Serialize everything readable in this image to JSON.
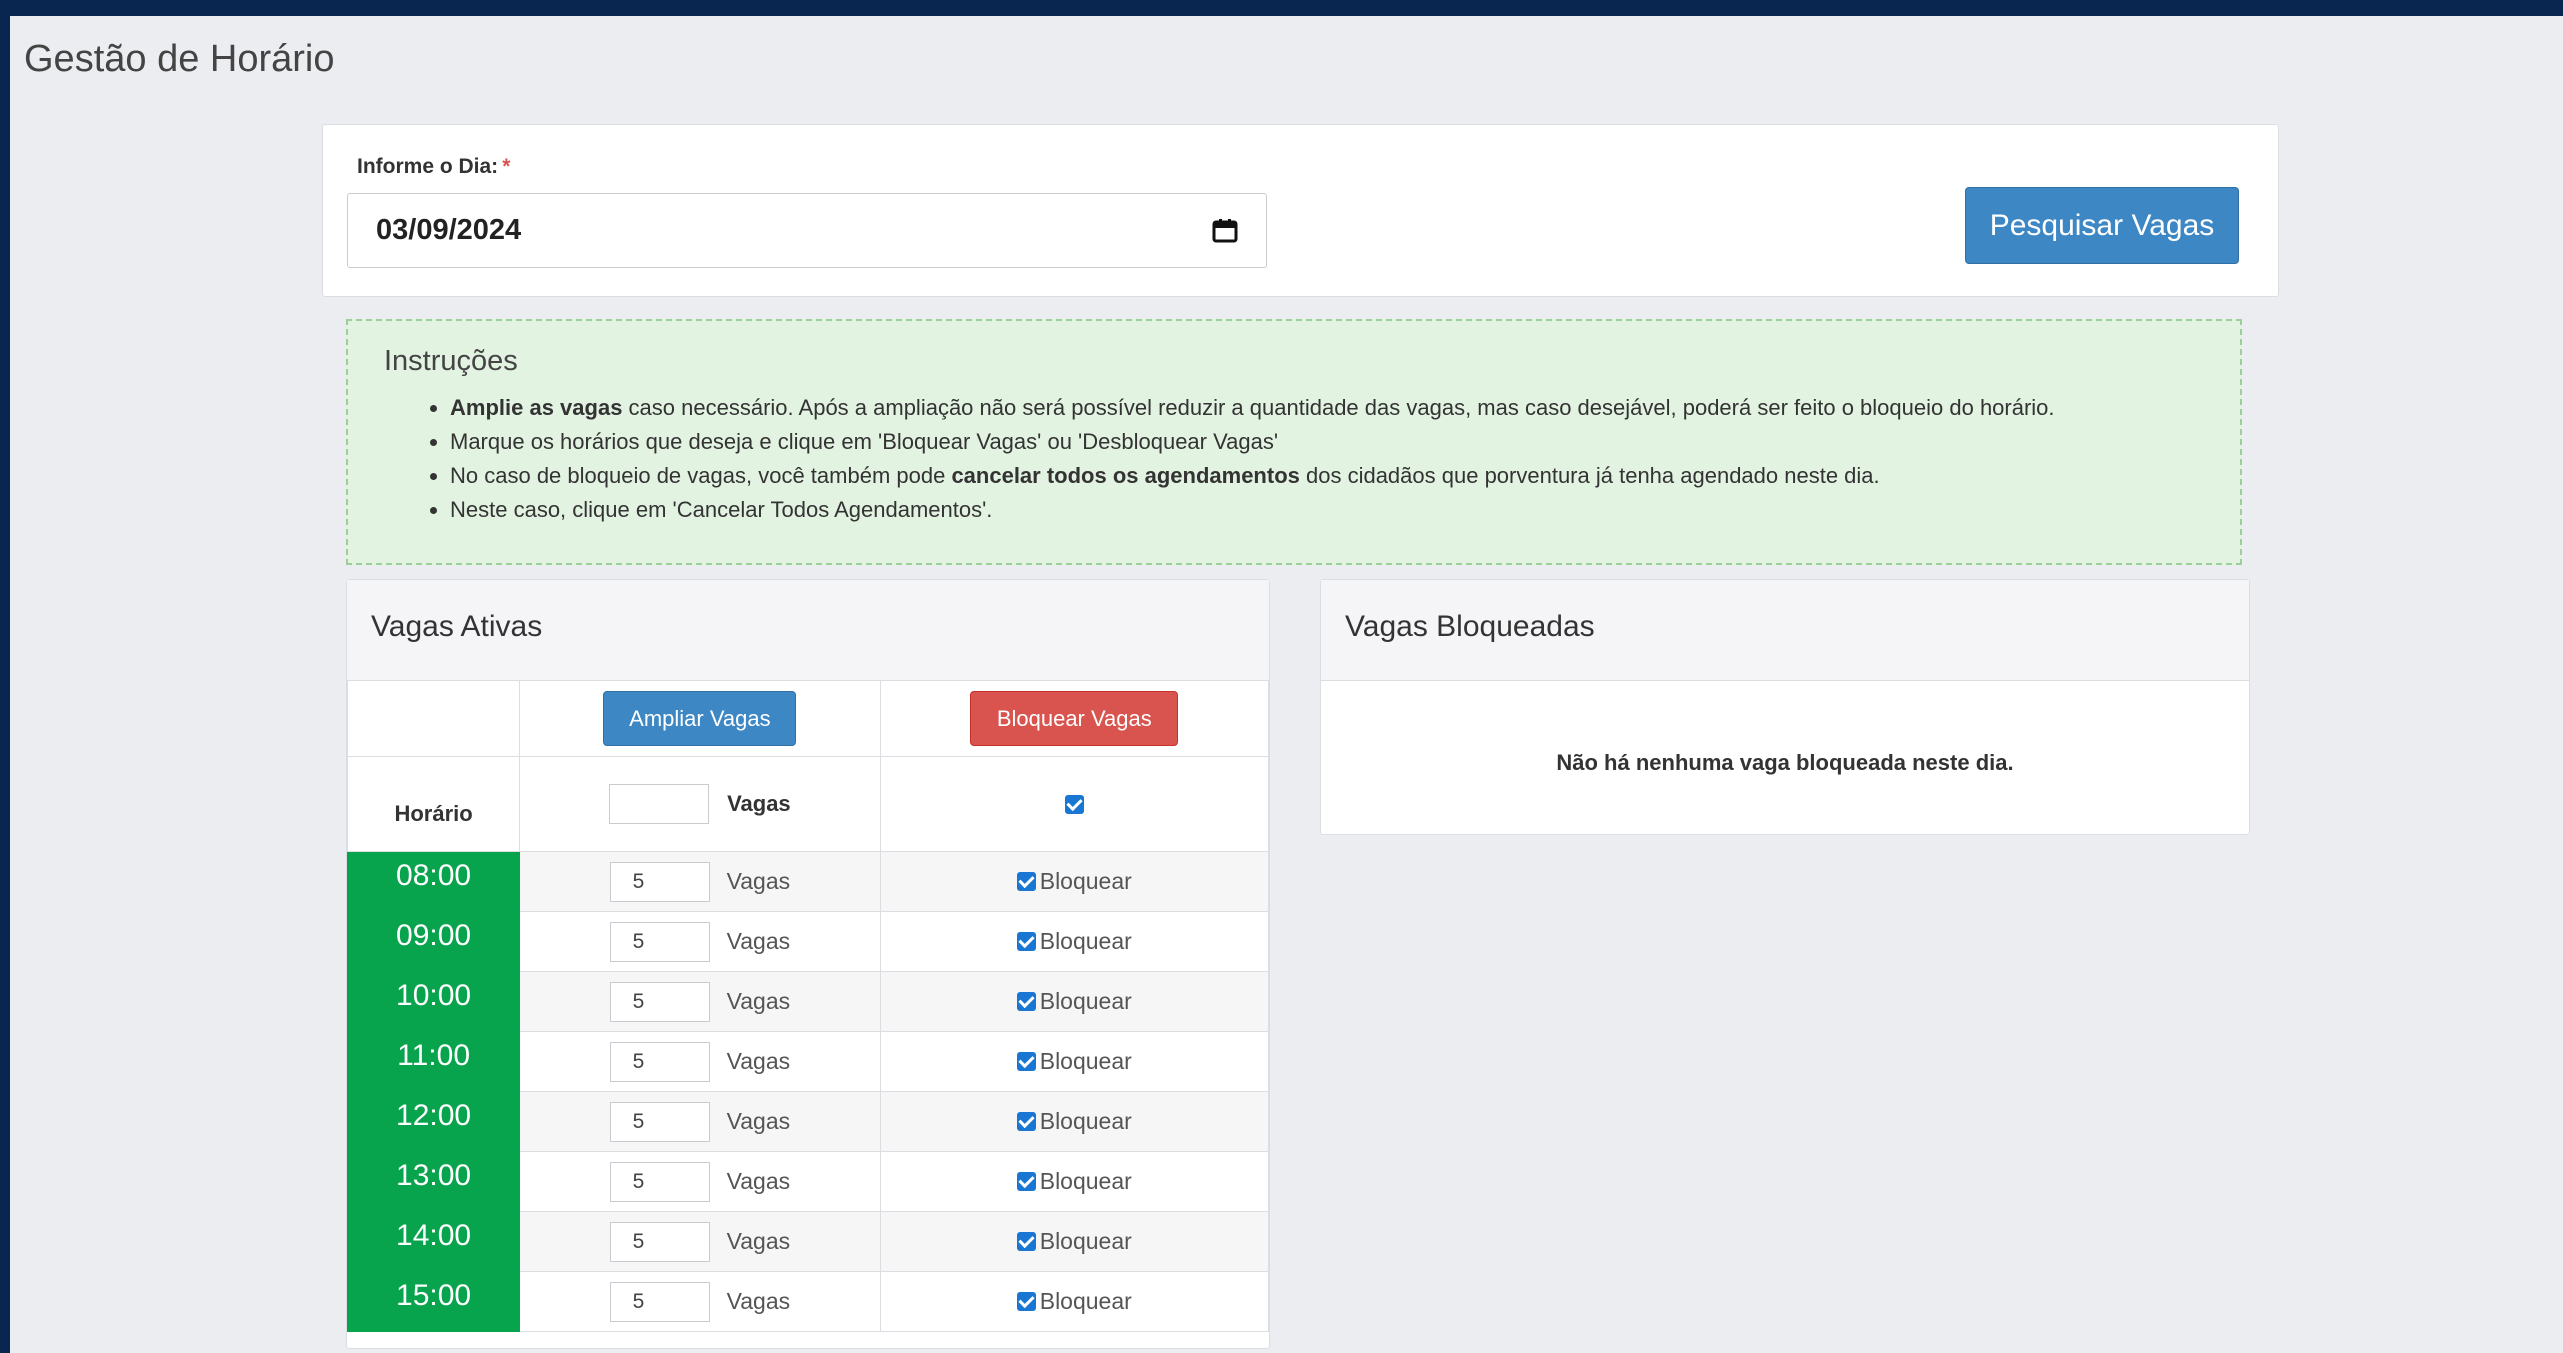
{
  "page": {
    "title": "Gestão de Horário"
  },
  "search": {
    "label": "Informe o Dia:",
    "required_mark": "*",
    "date_value": "03/09/2024",
    "button_label": "Pesquisar Vagas"
  },
  "instructions": {
    "title": "Instruções",
    "items": [
      {
        "bold": "Amplie as vagas",
        "text": " caso necessário. Após a ampliação não será possível reduzir a quantidade das vagas, mas caso desejável, poderá ser feito o bloqueio do horário."
      },
      {
        "pre": "Marque os horários que deseja e clique em 'Bloquear Vagas' ou 'Desbloquear Vagas'"
      },
      {
        "pre": "No caso de bloqueio de vagas, você também pode ",
        "bold": "cancelar todos os agendamentos",
        "text": " dos cidadãos que porventura já tenha agendado neste dia."
      },
      {
        "pre": "Neste caso, clique em 'Cancelar Todos Agendamentos'."
      }
    ]
  },
  "active": {
    "title": "Vagas Ativas",
    "ampliar_label": "Ampliar Vagas",
    "bloquear_label": "Bloquear Vagas",
    "horario_header": "Horário",
    "vagas_header": "Vagas",
    "rows": [
      {
        "time": "08:00",
        "vagas": "5",
        "vagas_label": "Vagas",
        "check_label": "Bloquear"
      },
      {
        "time": "09:00",
        "vagas": "5",
        "vagas_label": "Vagas",
        "check_label": "Bloquear"
      },
      {
        "time": "10:00",
        "vagas": "5",
        "vagas_label": "Vagas",
        "check_label": "Bloquear"
      },
      {
        "time": "11:00",
        "vagas": "5",
        "vagas_label": "Vagas",
        "check_label": "Bloquear"
      },
      {
        "time": "12:00",
        "vagas": "5",
        "vagas_label": "Vagas",
        "check_label": "Bloquear"
      },
      {
        "time": "13:00",
        "vagas": "5",
        "vagas_label": "Vagas",
        "check_label": "Bloquear"
      },
      {
        "time": "14:00",
        "vagas": "5",
        "vagas_label": "Vagas",
        "check_label": "Bloquear"
      },
      {
        "time": "15:00",
        "vagas": "5",
        "vagas_label": "Vagas",
        "check_label": "Bloquear"
      }
    ]
  },
  "blocked": {
    "title": "Vagas Bloqueadas",
    "empty_message": "Não há nenhuma vaga bloqueada neste dia."
  },
  "colors": {
    "primary": "#3c87c4",
    "danger": "#d9534f",
    "success": "#08a44d",
    "frame": "#082650"
  }
}
